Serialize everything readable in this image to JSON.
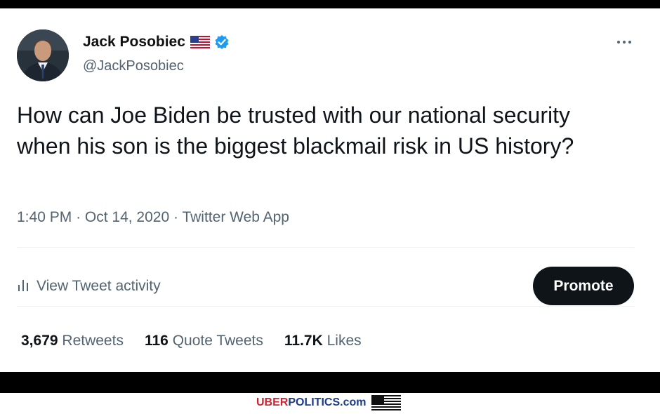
{
  "user": {
    "name": "Jack Posobiec",
    "handle": "@JackPosobiec",
    "flag_icon": "us-flag-icon",
    "verified_icon": "verified-badge-icon"
  },
  "tweet": {
    "text": "How can Joe Biden be trusted with our national security when his son is the biggest blackmail risk in US history?",
    "time": "1:40 PM",
    "date": "Oct 14, 2020",
    "source": "Twitter Web App",
    "separator": "·"
  },
  "actions": {
    "activity_label": "View Tweet activity",
    "activity_icon": "bar-chart-icon",
    "promote_label": "Promote",
    "more_icon": "more-dots-icon"
  },
  "stats": [
    {
      "count": "3,679",
      "label": "Retweets"
    },
    {
      "count": "116",
      "label": "Quote Tweets"
    },
    {
      "count": "11.7K",
      "label": "Likes"
    }
  ],
  "watermark": {
    "part1": "UBER",
    "part2": "POLITICS.com"
  },
  "colors": {
    "text": "#0f1419",
    "muted": "#536471",
    "verified": "#1d9bf0",
    "brand_red": "#d3202e",
    "brand_blue": "#1c3b8c"
  }
}
